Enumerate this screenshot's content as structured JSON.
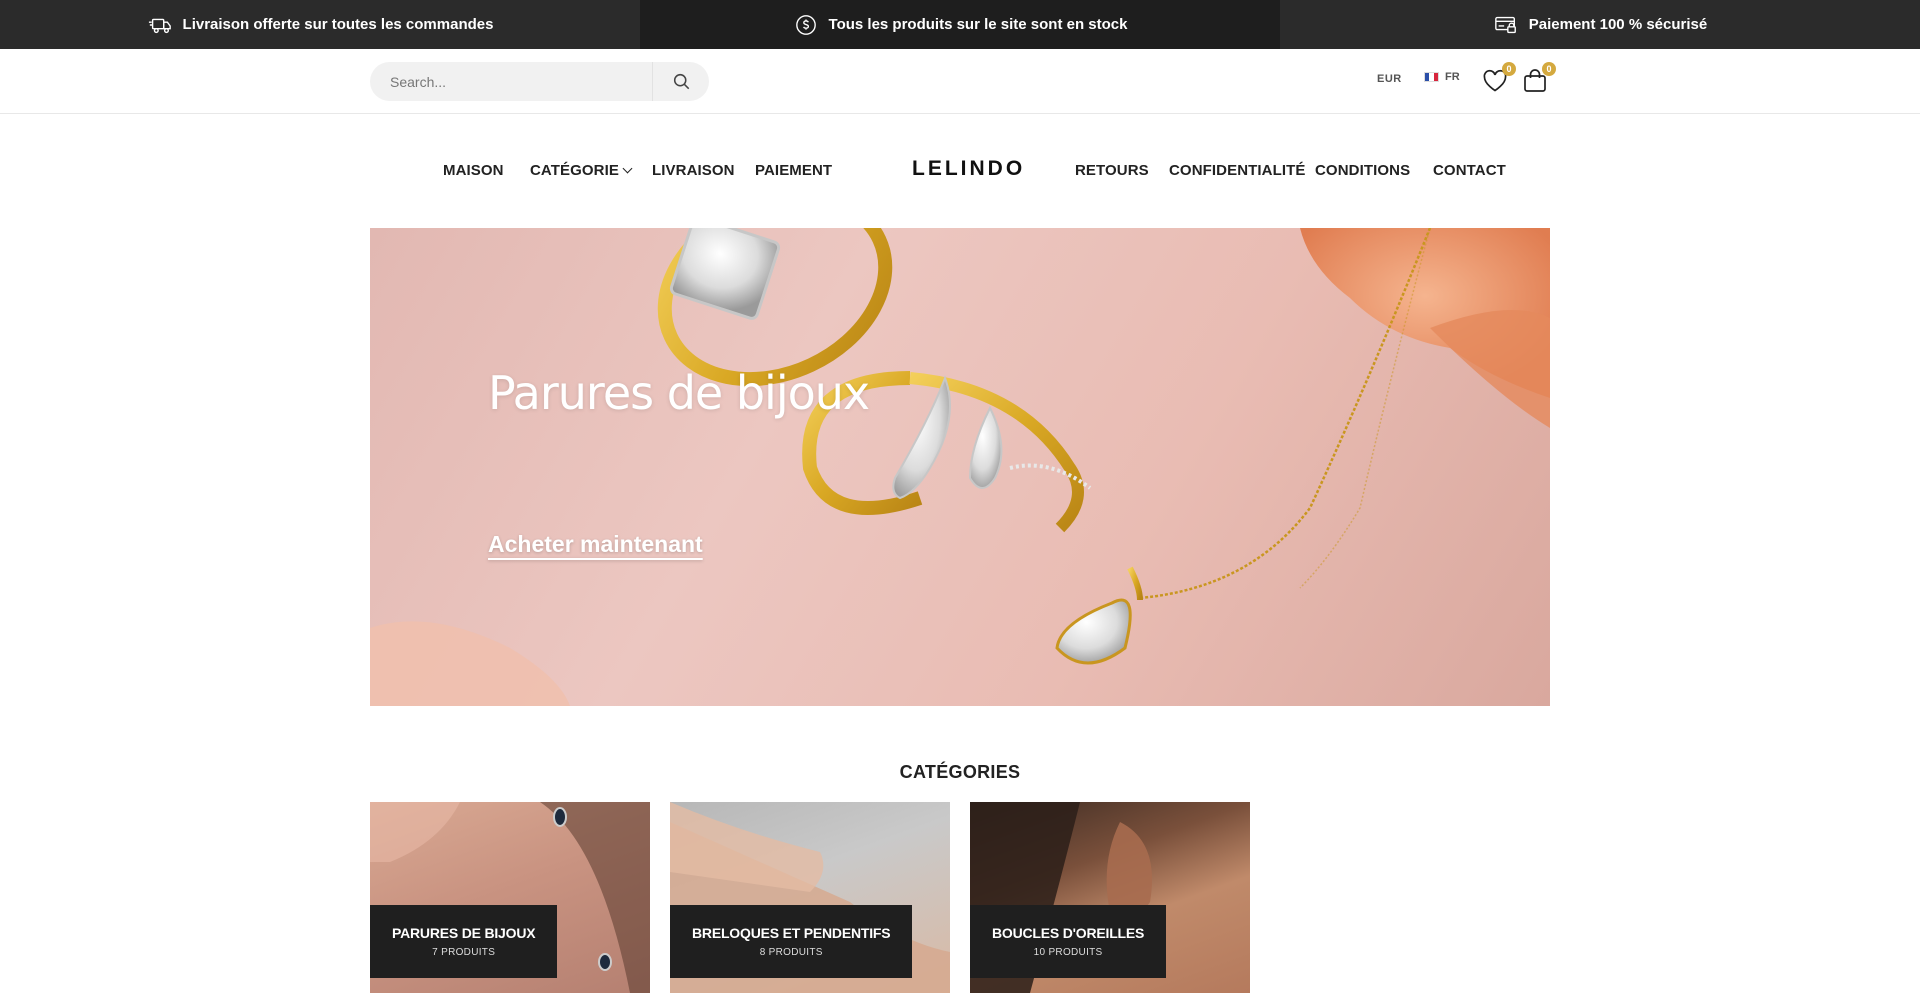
{
  "topbar": {
    "items": [
      {
        "icon": "delivery-truck-icon",
        "text": "Livraison offerte sur toutes les commandes"
      },
      {
        "icon": "dollar-coin-icon",
        "text": "Tous les produits sur le site sont en stock"
      },
      {
        "icon": "secure-card-icon",
        "text": "Paiement 100 % sécurisé"
      }
    ]
  },
  "header": {
    "search_placeholder": "Search...",
    "currency": "EUR",
    "language": "FR",
    "wishlist_count": "0",
    "cart_count": "0"
  },
  "nav": {
    "left": [
      "MAISON",
      "CATÉGORIE",
      "LIVRAISON",
      "PAIEMENT"
    ],
    "logo": "LELINDO",
    "right": [
      "RETOURS",
      "CONFIDENTIALITÉ",
      "CONDITIONS",
      "CONTACT"
    ]
  },
  "hero": {
    "title": "Parures de bijoux",
    "cta": "Acheter maintenant"
  },
  "categories": {
    "title": "CATÉGORIES",
    "items": [
      {
        "name": "PARURES DE BIJOUX",
        "count": "7 PRODUITS"
      },
      {
        "name": "BRELOQUES ET PENDENTIFS",
        "count": "8 PRODUITS"
      },
      {
        "name": "BOUCLES D'OREILLES",
        "count": "10 PRODUITS"
      }
    ]
  },
  "colors": {
    "topbar_bg": "#2b2b2b",
    "topbar_mid_bg": "#1e1e1e",
    "badge_gold": "#d4a93f",
    "hero_pink": "#e9bcb3"
  }
}
